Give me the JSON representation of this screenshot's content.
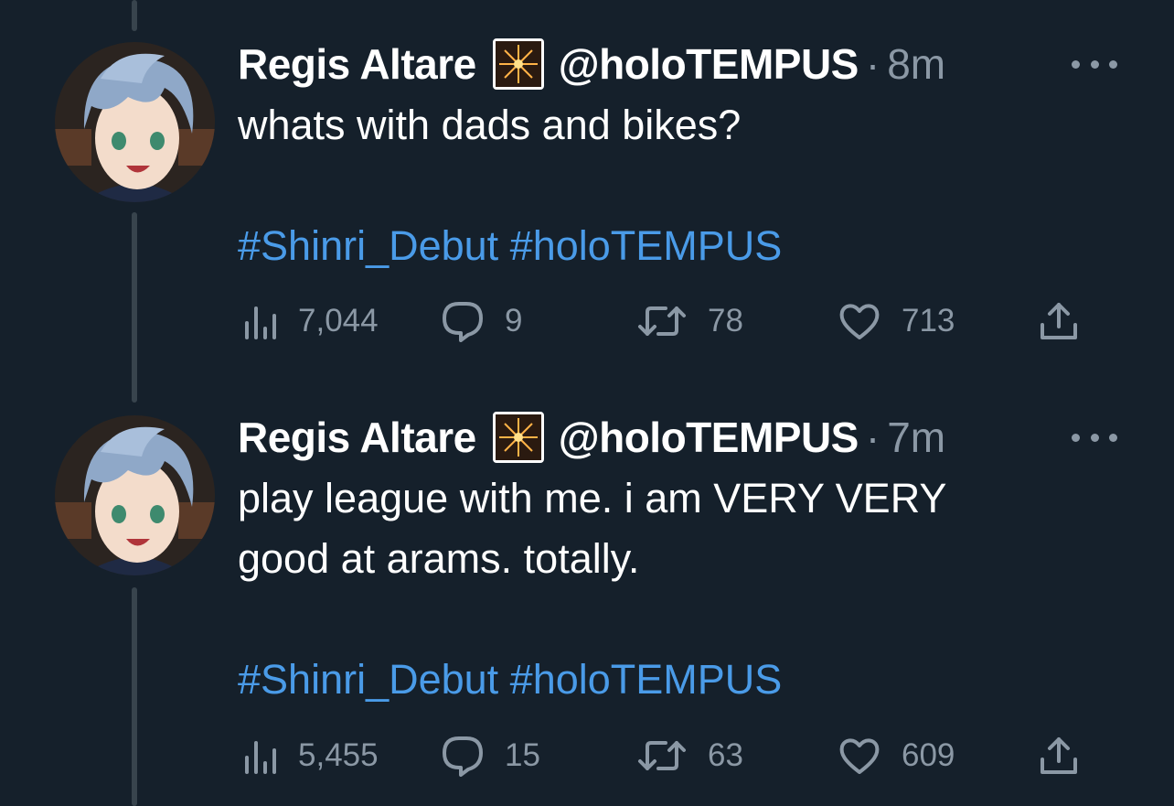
{
  "tweets": [
    {
      "display_name": "Regis Altare",
      "handle": "@holoTEMPUS",
      "separator": "·",
      "time": "8m",
      "text": "whats with dads and bikes?",
      "hashtags": "#Shinri_Debut #holoTEMPUS",
      "views": "7,044",
      "replies": "9",
      "retweets": "78",
      "likes": "713"
    },
    {
      "display_name": "Regis Altare",
      "handle": "@holoTEMPUS",
      "separator": "·",
      "time": "7m",
      "text_line1": "play league with me. i am VERY VERY",
      "text_line2": "good at arams. totally.",
      "hashtags": "#Shinri_Debut #holoTEMPUS",
      "views": "5,455",
      "replies": "15",
      "retweets": "63",
      "likes": "609"
    }
  ],
  "icons": {
    "badge": "fireworks-emoji-icon",
    "views": "analytics-icon",
    "reply": "reply-icon",
    "retweet": "retweet-icon",
    "like": "heart-icon",
    "share": "share-icon",
    "more": "more-icon"
  },
  "colors": {
    "background": "#15202b",
    "secondary_text": "#8b98a5",
    "hashtag": "#4a9be8",
    "thread_line": "#38444d"
  }
}
